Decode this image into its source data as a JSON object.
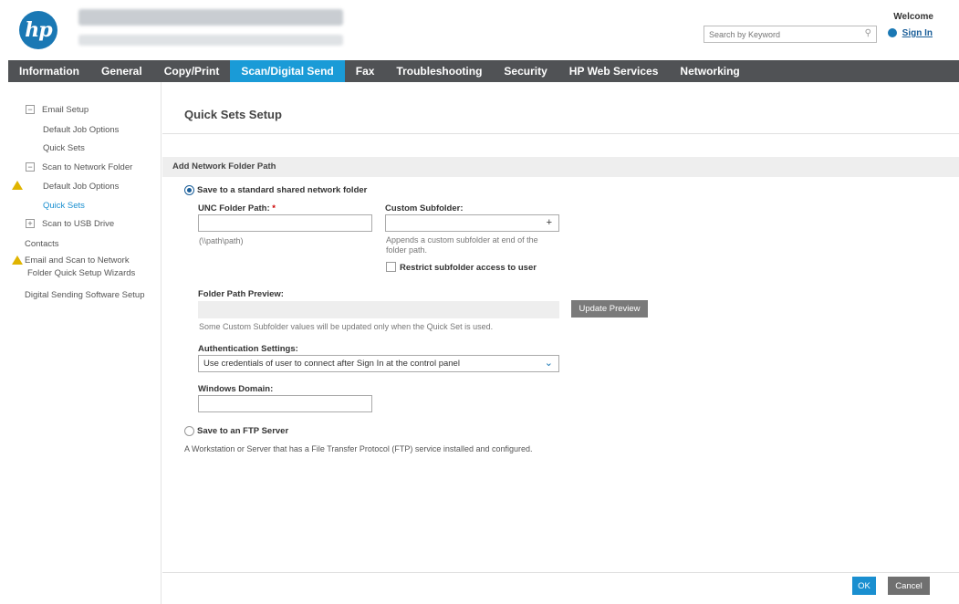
{
  "header": {
    "logo": "hp",
    "search_placeholder": "Search by Keyword",
    "welcome": "Welcome",
    "signin": "Sign In",
    "accent": "#1a78b4"
  },
  "nav": {
    "tabs": [
      "Information",
      "General",
      "Copy/Print",
      "Scan/Digital Send",
      "Fax",
      "Troubleshooting",
      "Security",
      "HP Web Services",
      "Networking"
    ],
    "active": "Scan/Digital Send",
    "bar_color": "#505255",
    "active_color": "#1a9bd7"
  },
  "sidebar": {
    "items": [
      {
        "label": "Email Setup"
      },
      {
        "label": "Default Job Options"
      },
      {
        "label": "Quick Sets"
      },
      {
        "label": "Scan to Network Folder"
      },
      {
        "label": "Default Job Options"
      },
      {
        "label": "Quick Sets"
      },
      {
        "label": "Scan to USB Drive"
      },
      {
        "label": "Contacts"
      },
      {
        "label": "Email and Scan to Network"
      },
      {
        "label": "Folder Quick Setup Wizards"
      },
      {
        "label": "Digital Sending Software Setup"
      }
    ]
  },
  "main": {
    "title": "Quick Sets Setup",
    "section": "Add Network Folder Path",
    "option_shared": "Save to a standard shared network folder",
    "unc_label": "UNC Folder Path:",
    "unc_required": "*",
    "unc_value": "",
    "unc_hint": "(\\\\path\\path)",
    "subfolder_label": "Custom Subfolder:",
    "subfolder_value": "",
    "subfolder_hint_1": "Appends a custom subfolder at end of the",
    "subfolder_hint_2": "folder path.",
    "restrict_label": "Restrict subfolder access to user",
    "preview_label": "Folder Path Preview:",
    "update_preview": "Update Preview",
    "preview_note": "Some Custom Subfolder values will be updated only when the Quick Set is used.",
    "auth_label": "Authentication Settings:",
    "auth_value": "Use credentials of user to connect after Sign In at the control panel",
    "domain_label": "Windows Domain:",
    "domain_value": "",
    "option_ftp": "Save to an FTP Server",
    "ftp_desc": "A Workstation or Server that has a File Transfer Protocol (FTP) service installed and configured.",
    "ok": "OK",
    "cancel": "Cancel"
  }
}
